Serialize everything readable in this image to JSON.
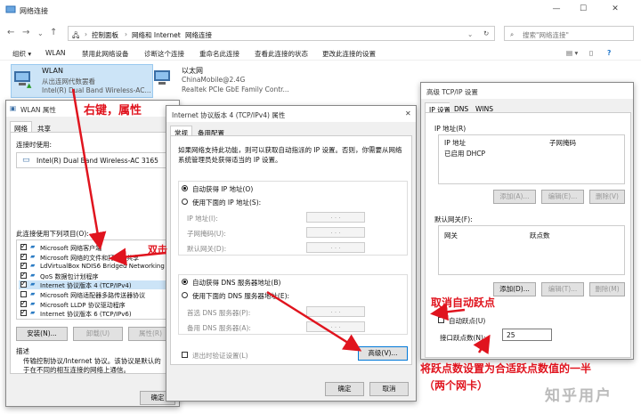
{
  "explorer": {
    "title": "网络连接",
    "breadcrumb": [
      "控制面板",
      "网络和 Internet",
      "网络连接"
    ],
    "search_placeholder": "搜索\"网络连接\"",
    "commands": [
      "组织 ▾",
      "WLAN",
      "禁用此网络设备",
      "诊断这个连接",
      "重命名此连接",
      "查看此连接的状态",
      "更改此连接的设置"
    ],
    "adapters": [
      {
        "name": "WLAN",
        "status": "从出连网代数罢看",
        "device": "Intel(R) Dual Band Wireless-AC..."
      },
      {
        "name": "以太网",
        "status": "ChinaMobile@2.4G",
        "device": "Realtek PCIe GbE Family Contr..."
      }
    ]
  },
  "wlan_props": {
    "title": "WLAN 属性",
    "tabs": [
      "网络",
      "共享"
    ],
    "connect_using_label": "连接时使用:",
    "adapter": "Intel(R) Dual Band Wireless-AC 3165",
    "items_label": "此连接使用下列项目(O):",
    "items": [
      {
        "label": "Microsoft 网络客户端",
        "checked": true
      },
      {
        "label": "Microsoft 网络的文件和打印机共享",
        "checked": true
      },
      {
        "label": "LdVirtualBox NDIS6 Bridged Networking",
        "checked": true
      },
      {
        "label": "QoS 数据包计划程序",
        "checked": true
      },
      {
        "label": "Internet 协议版本 4 (TCP/IPv4)",
        "checked": true
      },
      {
        "label": "Microsoft 网络适配器多路传送器协议",
        "checked": false
      },
      {
        "label": "Microsoft LLDP 协议驱动程序",
        "checked": true
      },
      {
        "label": "Internet 协议版本 6 (TCP/IPv6)",
        "checked": true
      }
    ],
    "install_btn": "安装(N)...",
    "uninstall_btn": "卸载(U)",
    "props_btn": "属性(R)",
    "desc_label": "描述",
    "desc_text_1": "传输控制协议/Internet 协议。该协议是默认的",
    "desc_text_2": "于在不同的相互连接的网络上通信。",
    "ok_btn": "确定"
  },
  "ipv4_props": {
    "title": "Internet 协议版本 4 (TCP/IPv4) 属性",
    "tabs": [
      "常规",
      "备用配置"
    ],
    "intro_1": "如果网络支持此功能，则可以获取自动指派的 IP 设置。否则，你需要从网络",
    "intro_2": "系统管理员处获得适当的 IP 设置。",
    "auto_ip": "自动获得 IP 地址(O)",
    "manual_ip": "使用下面的 IP 地址(S):",
    "ip_label": "IP 地址(I):",
    "mask_label": "子网掩码(U):",
    "gateway_label": "默认网关(D):",
    "auto_dns": "自动获得 DNS 服务器地址(B)",
    "manual_dns": "使用下面的 DNS 服务器地址(E):",
    "dns1_label": "首选 DNS 服务器(P):",
    "dns2_label": "备用 DNS 服务器(A):",
    "validate": "退出时验证设置(L)",
    "advanced_btn": "高级(V)...",
    "ok_btn": "确定",
    "cancel_btn": "取消",
    "field_placeholder": ".   .   ."
  },
  "adv_props": {
    "title": "高级 TCP/IP 设置",
    "tabs": [
      "IP 设置",
      "DNS",
      "WINS"
    ],
    "ip_section": "IP 地址(R)",
    "ip_col": "IP 地址",
    "mask_col": "子网掩码",
    "dhcp": "已启用 DHCP",
    "add_btn": "添加(A)...",
    "edit_btn": "编辑(E)...",
    "delete_btn": "删除(V)",
    "gw_section": "默认网关(F):",
    "gw_col": "网关",
    "metric_col": "跃点数",
    "add_btn2": "添加(D)...",
    "edit_btn2": "编辑(T)...",
    "delete_btn2": "删除(M)",
    "auto_metric": "自动跃点(U)",
    "iface_metric_label": "接口跃点数(N):",
    "iface_metric_value": "25"
  },
  "annotations": {
    "right_click": "右键，属性",
    "double_click": "双击",
    "cancel_auto": "取消自动跃点",
    "set_metric_1": "将跃点数设置为合适跃点数值的一半",
    "set_metric_2": "（两个网卡）",
    "watermark": "知乎用户"
  },
  "colors": {
    "annotation_red": "#e0141e",
    "focus_blue": "#0078d7"
  }
}
